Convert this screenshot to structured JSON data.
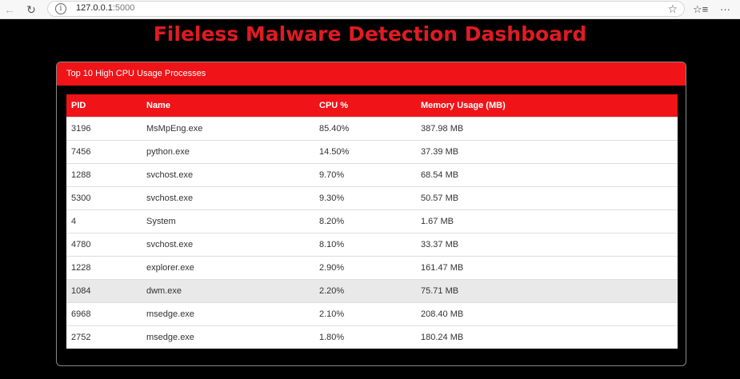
{
  "browser": {
    "url_host": "127.0.0.1",
    "url_port": ":5000"
  },
  "page": {
    "title": "Fileless Malware Detection Dashboard"
  },
  "card": {
    "header": "Top 10 High CPU Usage Processes",
    "columns": [
      "PID",
      "Name",
      "CPU %",
      "Memory Usage (MB)"
    ],
    "rows": [
      {
        "pid": "3196",
        "name": "MsMpEng.exe",
        "cpu": "85.40%",
        "mem": "387.98 MB"
      },
      {
        "pid": "7456",
        "name": "python.exe",
        "cpu": "14.50%",
        "mem": "37.39 MB"
      },
      {
        "pid": "1288",
        "name": "svchost.exe",
        "cpu": "9.70%",
        "mem": "68.54 MB"
      },
      {
        "pid": "5300",
        "name": "svchost.exe",
        "cpu": "9.30%",
        "mem": "50.57 MB"
      },
      {
        "pid": "4",
        "name": "System",
        "cpu": "8.20%",
        "mem": "1.67 MB"
      },
      {
        "pid": "4780",
        "name": "svchost.exe",
        "cpu": "8.10%",
        "mem": "33.37 MB"
      },
      {
        "pid": "1228",
        "name": "explorer.exe",
        "cpu": "2.90%",
        "mem": "161.47 MB"
      },
      {
        "pid": "1084",
        "name": "dwm.exe",
        "cpu": "2.20%",
        "mem": "75.71 MB"
      },
      {
        "pid": "6968",
        "name": "msedge.exe",
        "cpu": "2.10%",
        "mem": "208.40 MB"
      },
      {
        "pid": "2752",
        "name": "msedge.exe",
        "cpu": "1.80%",
        "mem": "180.24 MB"
      }
    ]
  },
  "colors": {
    "accent": "#f01418",
    "title": "#e01b22",
    "background": "#000000"
  }
}
